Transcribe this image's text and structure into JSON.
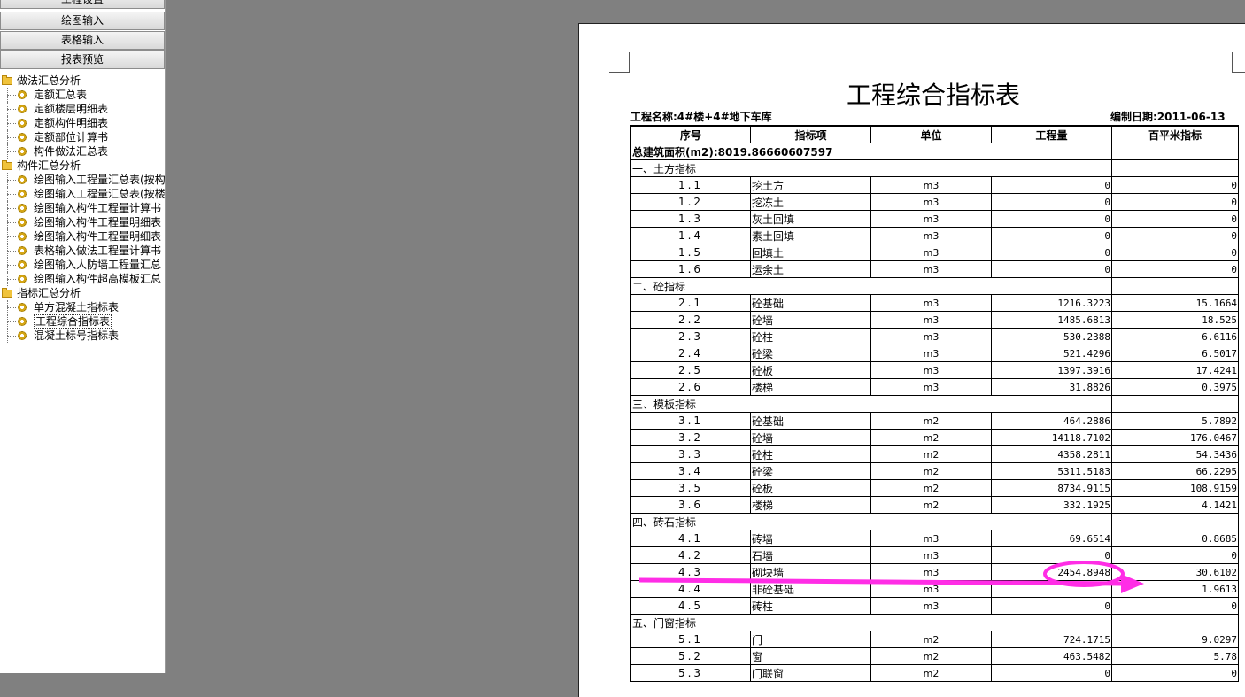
{
  "sidebar": {
    "buttons": [
      "工程设置",
      "绘图输入",
      "表格输入",
      "报表预览"
    ],
    "tree": [
      {
        "label": "做法汇总分析",
        "items": [
          "定额汇总表",
          "定额楼层明细表",
          "定额构件明细表",
          "定额部位计算书",
          "构件做法汇总表"
        ]
      },
      {
        "label": "构件汇总分析",
        "items": [
          "绘图输入工程量汇总表(按构",
          "绘图输入工程量汇总表(按楼",
          "绘图输入构件工程量计算书",
          "绘图输入构件工程量明细表",
          "绘图输入构件工程量明细表",
          "表格输入做法工程量计算书",
          "绘图输入人防墙工程量汇总",
          "绘图输入构件超高模板汇总"
        ]
      },
      {
        "label": "指标汇总分析",
        "items": [
          "单方混凝土指标表",
          "工程综合指标表",
          "混凝土标号指标表"
        ]
      }
    ],
    "selected_item": "工程综合指标表"
  },
  "report": {
    "title": "工程综合指标表",
    "project_label": "工程名称:4#楼+4#地下车库",
    "date_label": "编制日期:2011-06-13",
    "columns": [
      "序号",
      "指标项",
      "单位",
      "工程量",
      "百平米指标"
    ],
    "total_area": "总建筑面积(m2):8019.86660607597",
    "sections": [
      {
        "title": "一、土方指标",
        "rows": [
          [
            "1.1",
            "挖土方",
            "m3",
            "0",
            "0"
          ],
          [
            "1.2",
            "挖冻土",
            "m3",
            "0",
            "0"
          ],
          [
            "1.3",
            "灰土回填",
            "m3",
            "0",
            "0"
          ],
          [
            "1.4",
            "素土回填",
            "m3",
            "0",
            "0"
          ],
          [
            "1.5",
            "回填土",
            "m3",
            "0",
            "0"
          ],
          [
            "1.6",
            "运余土",
            "m3",
            "0",
            "0"
          ]
        ]
      },
      {
        "title": "二、砼指标",
        "rows": [
          [
            "2.1",
            "砼基础",
            "m3",
            "1216.3223",
            "15.1664"
          ],
          [
            "2.2",
            "砼墙",
            "m3",
            "1485.6813",
            "18.525"
          ],
          [
            "2.3",
            "砼柱",
            "m3",
            "530.2388",
            "6.6116"
          ],
          [
            "2.4",
            "砼梁",
            "m3",
            "521.4296",
            "6.5017"
          ],
          [
            "2.5",
            "砼板",
            "m3",
            "1397.3916",
            "17.4241"
          ],
          [
            "2.6",
            "楼梯",
            "m3",
            "31.8826",
            "0.3975"
          ]
        ]
      },
      {
        "title": "三、模板指标",
        "rows": [
          [
            "3.1",
            "砼基础",
            "m2",
            "464.2886",
            "5.7892"
          ],
          [
            "3.2",
            "砼墙",
            "m2",
            "14118.7102",
            "176.0467"
          ],
          [
            "3.3",
            "砼柱",
            "m2",
            "4358.2811",
            "54.3436"
          ],
          [
            "3.4",
            "砼梁",
            "m2",
            "5311.5183",
            "66.2295"
          ],
          [
            "3.5",
            "砼板",
            "m2",
            "8734.9115",
            "108.9159"
          ],
          [
            "3.6",
            "楼梯",
            "m2",
            "332.1925",
            "4.1421"
          ]
        ]
      },
      {
        "title": "四、砖石指标",
        "rows": [
          [
            "4.1",
            "砖墙",
            "m3",
            "69.6514",
            "0.8685"
          ],
          [
            "4.2",
            "石墙",
            "m3",
            "0",
            "0"
          ],
          [
            "4.3",
            "砌块墙",
            "m3",
            "2454.8948",
            "30.6102"
          ],
          [
            "4.4",
            "非砼基础",
            "m3",
            "",
            "1.9613"
          ],
          [
            "4.5",
            "砖柱",
            "m3",
            "0",
            "0"
          ]
        ]
      },
      {
        "title": "五、门窗指标",
        "rows": [
          [
            "5.1",
            "门",
            "m2",
            "724.1715",
            "9.0297"
          ],
          [
            "5.2",
            "窗",
            "m2",
            "463.5482",
            "5.78"
          ],
          [
            "5.3",
            "门联窗",
            "m2",
            "0",
            "0"
          ]
        ]
      }
    ]
  },
  "annotation": {
    "color": "#ff2de6"
  }
}
